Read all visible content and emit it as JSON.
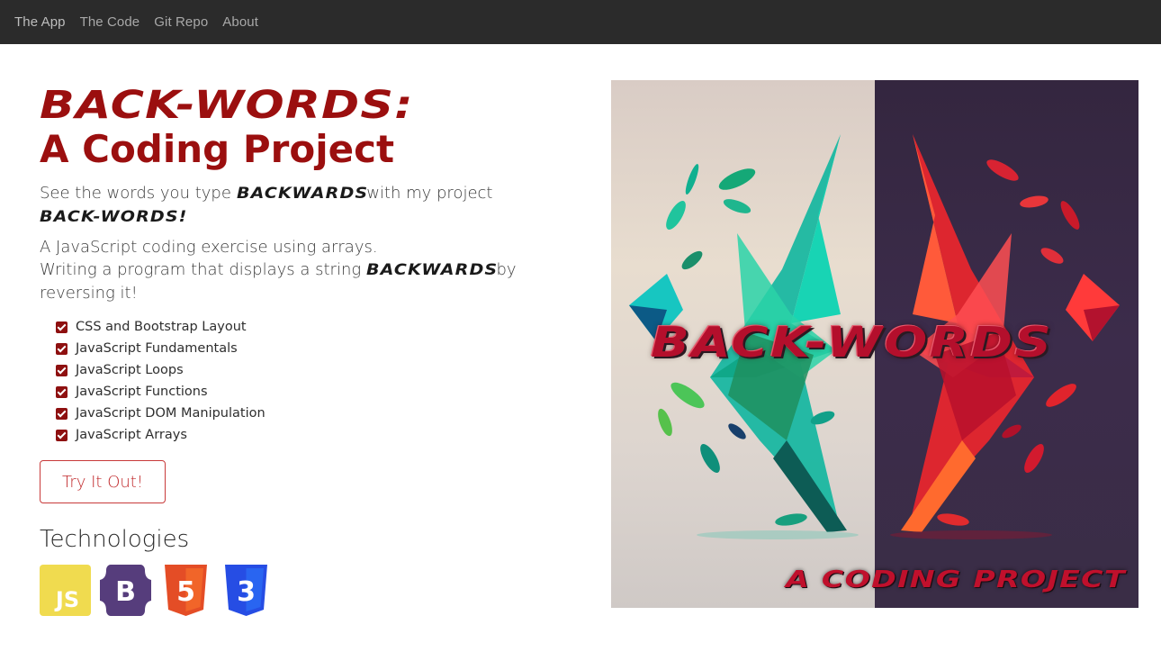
{
  "nav": {
    "items": [
      {
        "label": "The App"
      },
      {
        "label": "The Code"
      },
      {
        "label": "Git Repo"
      },
      {
        "label": "About"
      }
    ]
  },
  "hero_text": {
    "logo_title": "BACK-WORDS:",
    "subtitle": "A Coding Project",
    "lead1_prefix": "See the words you type",
    "lead1_word": "BACKWARDS",
    "lead1_suffix": "with my project",
    "lead1_project": "BACK-WORDS!",
    "lead2_line1": "A JavaScript coding exercise using arrays.",
    "lead2_line2_prefix": "Writing a program that displays a string",
    "lead2_word": "BACKWARDS",
    "lead2_line2_suffix": "by reversing it!"
  },
  "checklist": [
    {
      "label": "CSS and Bootstrap Layout",
      "checked": true
    },
    {
      "label": "JavaScript Fundamentals",
      "checked": true
    },
    {
      "label": "JavaScript Loops",
      "checked": true
    },
    {
      "label": "JavaScript Functions",
      "checked": true
    },
    {
      "label": "JavaScript DOM Manipulation",
      "checked": true
    },
    {
      "label": "JavaScript Arrays",
      "checked": true
    }
  ],
  "cta": {
    "label": "Try It Out!"
  },
  "technologies": {
    "heading": "Technologies",
    "icons": [
      {
        "name": "javascript-icon",
        "text": "JS",
        "color": "#f0db4f"
      },
      {
        "name": "bootstrap-icon",
        "text": "B",
        "color": "#563d7c"
      },
      {
        "name": "html5-icon",
        "text": "5",
        "color": "#e44d26"
      },
      {
        "name": "css3-icon",
        "text": "3",
        "color": "#264de4"
      }
    ]
  },
  "hero_image": {
    "logo": "BACK-WORDS",
    "caption": "A CODING PROJECT"
  },
  "colors": {
    "brand": "#9b0f0f",
    "navbar_bg": "#2b2b2b",
    "button_border": "#c83a3a"
  }
}
